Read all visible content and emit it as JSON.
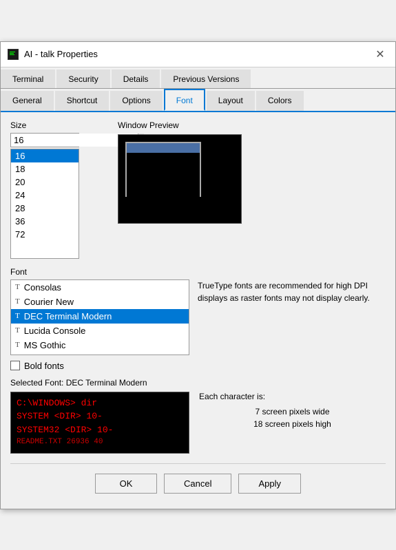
{
  "window": {
    "title": "AI - talk Properties",
    "icon": "terminal-icon"
  },
  "tabs_row1": [
    {
      "id": "terminal",
      "label": "Terminal"
    },
    {
      "id": "security",
      "label": "Security"
    },
    {
      "id": "details",
      "label": "Details"
    },
    {
      "id": "previous-versions",
      "label": "Previous Versions"
    }
  ],
  "tabs_row2": [
    {
      "id": "general",
      "label": "General"
    },
    {
      "id": "shortcut",
      "label": "Shortcut"
    },
    {
      "id": "options",
      "label": "Options"
    },
    {
      "id": "font",
      "label": "Font",
      "active": true
    },
    {
      "id": "layout",
      "label": "Layout"
    },
    {
      "id": "colors",
      "label": "Colors"
    }
  ],
  "size_section": {
    "label": "Size",
    "current_value": "16",
    "items": [
      "16",
      "18",
      "20",
      "24",
      "28",
      "36",
      "72"
    ]
  },
  "window_preview": {
    "label": "Window Preview"
  },
  "font_section": {
    "label": "Font",
    "items": [
      {
        "name": "Consolas"
      },
      {
        "name": "Courier New"
      },
      {
        "name": "DEC Terminal Modern",
        "selected": true
      },
      {
        "name": "Lucida Console"
      },
      {
        "name": "MS Gothic"
      }
    ],
    "hint": "TrueType fonts are recommended for high DPI displays as raster fonts may not display clearly.",
    "bold_fonts_label": "Bold fonts",
    "bold_fonts_checked": false
  },
  "selected_font": {
    "label": "Selected Font: DEC Terminal Modern",
    "preview_lines": [
      "C:\\WINDOWS> dir",
      "SYSTEM         <DIR>    10-",
      "SYSTEM32       <DIR>    10-",
      "README.TXT          26936 40"
    ],
    "char_info": {
      "title": "Each character is:",
      "width": "7 screen pixels wide",
      "height": "18 screen pixels high"
    }
  },
  "buttons": {
    "ok": "OK",
    "cancel": "Cancel",
    "apply": "Apply"
  }
}
